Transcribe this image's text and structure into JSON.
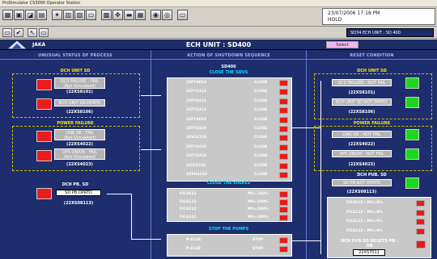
{
  "window_title": "ProSimulator CS3000 Operator Station",
  "infobox": {
    "datetime": "23/07/2006 17:18 PM",
    "status": "HOLD"
  },
  "tag_field": "SD34 ECH UNIT : SD 400",
  "header": {
    "site": "JAKA",
    "title": "ECH UNIT : SD400",
    "mode_button": "Select"
  },
  "sections": {
    "left": "UNUSUAL STATUS OF PROCESS",
    "middle": "ACTION OF SHUTDOWN SEQUENCE",
    "right": "RESET CONDITION"
  },
  "left": {
    "dch_title": "DCH UNIT SD",
    "dcs_failure": "DCS FAILURE : FAIL",
    "not_simulated_1": "(Not Simulated)",
    "dcs_failure_tag": "(22XS8101)",
    "ech_unit": "ECH UNIT SD:OPRTD",
    "ech_unit_tag": "(22XS8106)",
    "power_title": "POWER FAILURE",
    "link_ok": "LINK OK : FAIL",
    "not_simulated_2": "(Not Simulated)",
    "link_ok_tag": "(22XS4022)",
    "ups_on": "UPS ON/OK : FAIL",
    "not_simulated_3": "(Not Simulated)",
    "ups_on_tag": "(22XS4023)",
    "dch_pb_title": "DCH PB. SD",
    "sd_pb": "SD PB:OPRTD",
    "sd_pb_tag": "(22XS08113)"
  },
  "middle": {
    "sd_label": "SD400",
    "sdvs_title": "CLOSE THE SDVS",
    "sdvs": [
      {
        "tag": "22FY4012",
        "state": "CLOSE"
      },
      {
        "tag": "22FY4112",
        "state": "CLOSE"
      },
      {
        "tag": "22FY4212",
        "state": "CLOSE"
      },
      {
        "tag": "22FY4312",
        "state": "CLOSE"
      },
      {
        "tag": "22FY4010",
        "state": "CLOSE"
      },
      {
        "tag": "22FY4110",
        "state": "CLOSE"
      },
      {
        "tag": "22VL4110",
        "state": "CLOSE"
      },
      {
        "tag": "22FY4210",
        "state": "CLOSE"
      },
      {
        "tag": "22FY4310",
        "state": "CLOSE"
      },
      {
        "tag": "22LY4310",
        "state": "CLOSE"
      },
      {
        "tag": "22XH4310",
        "state": "CLOSE"
      }
    ],
    "valves_title": "CLOSE THE VALVES",
    "valves": [
      {
        "tag": "FIC4012",
        "state": "MV=100%"
      },
      {
        "tag": "FIC4112",
        "state": "MV=100%"
      },
      {
        "tag": "FIC4212",
        "state": "MV=100%"
      },
      {
        "tag": "FIC4312",
        "state": "MV=100%"
      }
    ],
    "pumps_title": "STOP THE PUMPS",
    "pumps": [
      {
        "tag": "P-412A",
        "state": "STOP"
      },
      {
        "tag": "P-412B",
        "state": "STOP"
      }
    ]
  },
  "right": {
    "dch_title": "DCH UNIT SD",
    "dcs_failure": "DCS FAILURE : NOT FAIL",
    "dcs_failure_tag": "(22XS8101)",
    "ech_unit": "ECH UNIT SD:NOT OPRTD",
    "ech_unit_tag": "(22XS8106)",
    "power_title": "POWER FAILURE",
    "link_ok": "LINK OK : NOT FAIL",
    "link_ok_tag": "(22XS4022)",
    "ups_on": "UPS ON/OK : NOT FAIL",
    "ups_on_tag": "(22XS4023)",
    "dch_pb_title": "DCH PUB. SD",
    "sd_pb": "SD PB:NOT OPRTD",
    "sd_pb_tag": "(22XS08113)",
    "fic_rows": [
      {
        "label": "FIC4012 : MV=0%"
      },
      {
        "label": "FIC4112 : MV=0%"
      },
      {
        "label": "FIC4212 : MV=0%"
      },
      {
        "label": "FIC4312 : MV=0%"
      }
    ],
    "reset_label": "DCH PUB SD RESETS PB :",
    "reset_state": "ON",
    "reset_tag": "22XS7011"
  }
}
